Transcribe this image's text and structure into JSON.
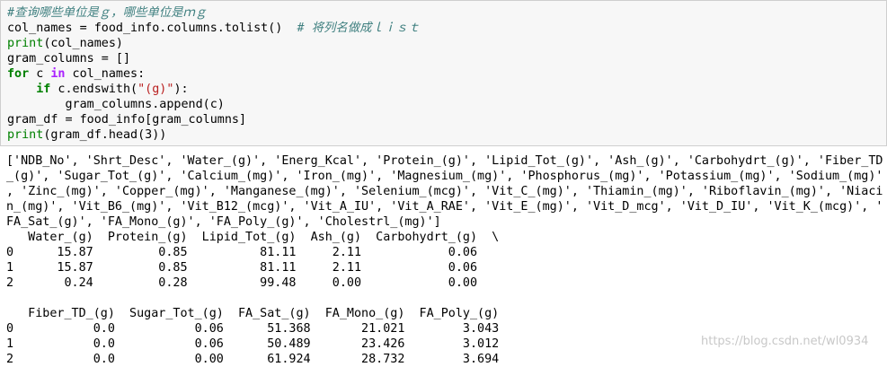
{
  "code": {
    "line1_comment": "#查询哪些单位是ｇ，哪些单位是ｍｇ",
    "line2_a": "col_names = food_info.columns.tolist()  ",
    "line2_comment": "# 将列名做成ｌｉｓｔ",
    "line3_fn": "print",
    "line3_rest": "(col_names)",
    "line4": "gram_columns = []",
    "line5_kw1": "for",
    "line5_mid": " c ",
    "line5_kw2": "in",
    "line5_rest": " col_names:",
    "line6_indent": "    ",
    "line6_kw": "if",
    "line6_mid": " c.endswith(",
    "line6_str": "\"(g)\"",
    "line6_end": "):",
    "line7": "        gram_columns.append(c)",
    "line8": "gram_df = food_info[gram_columns]",
    "line9_fn": "print",
    "line9_rest": "(gram_df.head(3))"
  },
  "output": {
    "list_lines": [
      "['NDB_No', 'Shrt_Desc', 'Water_(g)', 'Energ_Kcal', 'Protein_(g)', 'Lipid_Tot_(g)', 'Ash_(g)', 'Carbohydrt_(g)', 'Fiber_TD",
      "_(g)', 'Sugar_Tot_(g)', 'Calcium_(mg)', 'Iron_(mg)', 'Magnesium_(mg)', 'Phosphorus_(mg)', 'Potassium_(mg)', 'Sodium_(mg)'",
      ", 'Zinc_(mg)', 'Copper_(mg)', 'Manganese_(mg)', 'Selenium_(mcg)', 'Vit_C_(mg)', 'Thiamin_(mg)', 'Riboflavin_(mg)', 'Niaci",
      "n_(mg)', 'Vit_B6_(mg)', 'Vit_B12_(mcg)', 'Vit_A_IU', 'Vit_A_RAE', 'Vit_E_(mg)', 'Vit_D_mcg', 'Vit_D_IU', 'Vit_K_(mcg)', '",
      "FA_Sat_(g)', 'FA_Mono_(g)', 'FA_Poly_(g)', 'Cholestrl_(mg)']"
    ],
    "table1_lines": [
      "   Water_(g)  Protein_(g)  Lipid_Tot_(g)  Ash_(g)  Carbohydrt_(g)  \\",
      "0      15.87         0.85          81.11     2.11            0.06   ",
      "1      15.87         0.85          81.11     2.11            0.06   ",
      "2       0.24         0.28          99.48     0.00            0.00   "
    ],
    "table2_lines": [
      "   Fiber_TD_(g)  Sugar_Tot_(g)  FA_Sat_(g)  FA_Mono_(g)  FA_Poly_(g)",
      "0           0.0           0.06      51.368       21.021        3.043",
      "1           0.0           0.06      50.489       23.426        3.012",
      "2           0.0           0.00      61.924       28.732        3.694"
    ]
  },
  "watermark": "https://blog.csdn.net/wl0934"
}
